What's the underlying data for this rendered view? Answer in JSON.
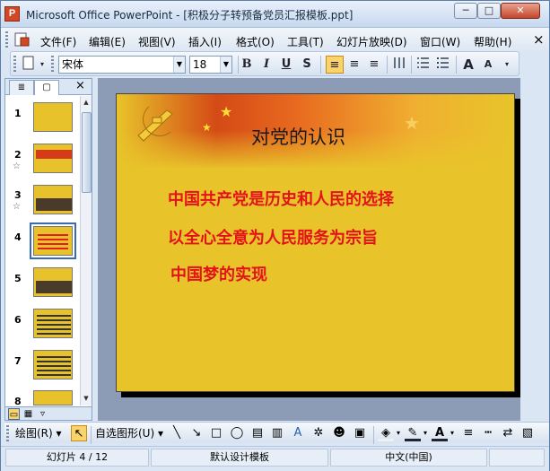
{
  "window": {
    "title": "Microsoft Office PowerPoint - [积极分子转预备党员汇报模板.ppt]",
    "app_icon": "powerpoint-icon",
    "controls": {
      "minimize": "─",
      "maximize": "□",
      "close": "✕"
    }
  },
  "menubar": {
    "items": [
      {
        "label": "文件(F)"
      },
      {
        "label": "编辑(E)"
      },
      {
        "label": "视图(V)"
      },
      {
        "label": "插入(I)"
      },
      {
        "label": "格式(O)"
      },
      {
        "label": "工具(T)"
      },
      {
        "label": "幻灯片放映(D)"
      },
      {
        "label": "窗口(W)"
      },
      {
        "label": "帮助(H)"
      }
    ],
    "close_glyph": "×"
  },
  "toolbar": {
    "font_name": "宋体",
    "font_size": "18",
    "bold": "B",
    "italic": "I",
    "underline": "U",
    "shadow": "S",
    "align_left": "≡",
    "align_center": "≡",
    "align_right": "≡",
    "increase_font": "A",
    "decrease_font": "A"
  },
  "outline_panel": {
    "tab_outline": "≣",
    "tab_slides": "▢",
    "close": "×",
    "slides": [
      {
        "num": "1",
        "star": "",
        "style": "plain"
      },
      {
        "num": "2",
        "star": "☆",
        "style": "red"
      },
      {
        "num": "3",
        "star": "☆",
        "style": "dark"
      },
      {
        "num": "4",
        "star": "",
        "style": "lines",
        "selected": true
      },
      {
        "num": "5",
        "star": "",
        "style": "dark"
      },
      {
        "num": "6",
        "star": "",
        "style": "black"
      },
      {
        "num": "7",
        "star": "",
        "style": "black"
      },
      {
        "num": "8",
        "star": "",
        "style": "plain"
      }
    ]
  },
  "slide": {
    "title": "对党的认识",
    "bullets": [
      "中国共产党是历史和人民的选择",
      "以全心全意为人民服务为宗旨",
      "中国梦的实现"
    ],
    "colors": {
      "background": "#e8c42a",
      "bullet_text": "#e4131a",
      "banner_red": "#d44a16"
    }
  },
  "drawbar": {
    "draw_label": "绘图(R)",
    "autoshape_label": "自选图形(U)"
  },
  "statusbar": {
    "slide_info": "幻灯片 4 / 12",
    "template": "默认设计模板",
    "language": "中文(中国)"
  }
}
